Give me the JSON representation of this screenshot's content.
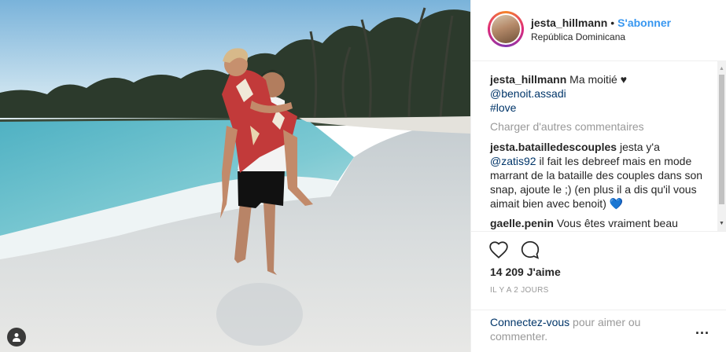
{
  "post": {
    "username": "jesta_hillmann",
    "separator": "•",
    "follow_label": "S'abonner",
    "location": "República Dominicana"
  },
  "caption": {
    "username": "jesta_hillmann",
    "text": "Ma moitié ♥",
    "mention": "@benoit.assadi",
    "hashtag": "#love"
  },
  "comments": {
    "load_more": "Charger d'autres commentaires",
    "items": [
      {
        "username": "jesta.batailledescouples",
        "text_before": "jesta y'a",
        "mention": "@zatis92",
        "text_after": "il fait les debreef mais en mode marrant de la bataille des couples dans son snap, ajoute le ;) (en plus il a dis qu'il vous aimait bien avec benoit) 💙"
      },
      {
        "username": "gaelle.penin",
        "text": "Vous êtes vraiment beau"
      }
    ]
  },
  "actions": {
    "like_icon": "heart-icon",
    "comment_icon": "comment-icon",
    "likes": "14 209 J'aime",
    "time_ago": "IL Y A 2 JOURS"
  },
  "footer": {
    "login_link": "Connectez-vous",
    "login_text": " pour aimer ou commenter.",
    "more_label": "..."
  },
  "colors": {
    "accent": "#3897f0",
    "link": "#003569",
    "muted": "#999999",
    "text": "#262626"
  }
}
